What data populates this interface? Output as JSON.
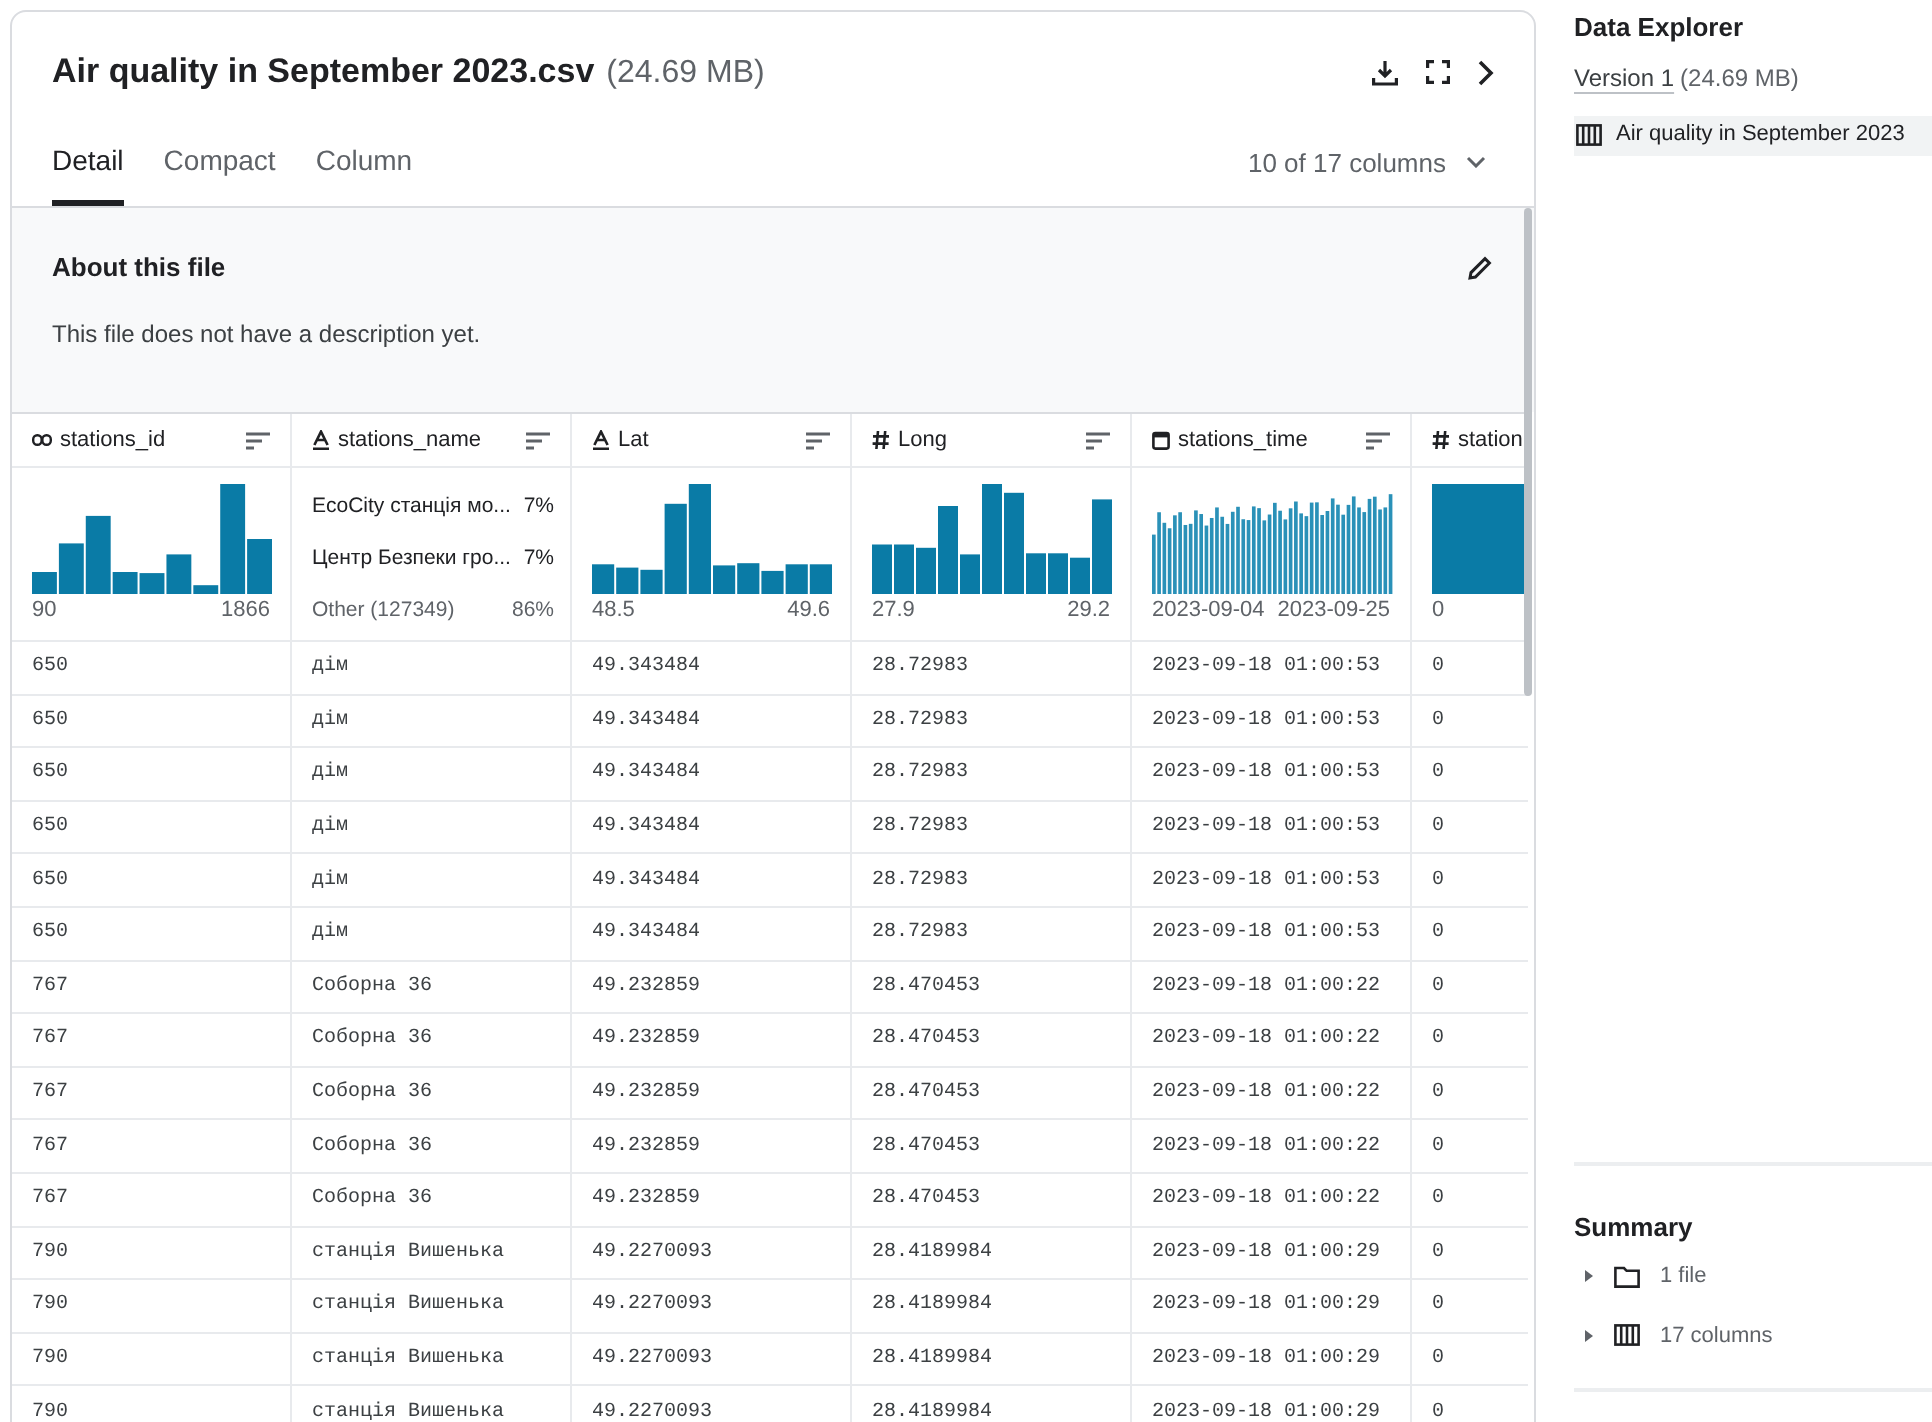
{
  "file": {
    "title": "Air quality in September 2023.csv",
    "size": "(24.69 MB)"
  },
  "tabs": [
    {
      "label": "Detail",
      "selected": true
    },
    {
      "label": "Compact",
      "selected": false
    },
    {
      "label": "Column",
      "selected": false
    }
  ],
  "column_count": "10 of 17 columns",
  "about": {
    "title": "About this file",
    "description": "This file does not have a description yet."
  },
  "table": {
    "columns": [
      {
        "name": "stations_id",
        "kind": "id",
        "summary": {
          "kind": "histogram",
          "min": "90",
          "max": "1866"
        }
      },
      {
        "name": "stations_name",
        "kind": "string",
        "summary": {
          "kind": "categories",
          "items": [
            {
              "label": "EcoCity станція мо...",
              "share": "7%",
              "muted": false
            },
            {
              "label": "Центр Безпеки гро...",
              "share": "7%",
              "muted": false
            },
            {
              "label": "Other (127349)",
              "share": "86%",
              "muted": true
            }
          ]
        }
      },
      {
        "name": "Lat",
        "kind": "string",
        "summary": {
          "kind": "histogram",
          "min": "48.5",
          "max": "49.6"
        }
      },
      {
        "name": "Long",
        "kind": "number",
        "summary": {
          "kind": "histogram",
          "min": "27.9",
          "max": "29.2"
        }
      },
      {
        "name": "stations_time",
        "kind": "date",
        "summary": {
          "kind": "timeline",
          "min": "2023-09-04",
          "max": "2023-09-25"
        }
      },
      {
        "name": "station",
        "kind": "number",
        "summary": {
          "kind": "histogram",
          "min": "0"
        }
      }
    ],
    "rows": [
      [
        "650",
        "дім",
        "49.343484",
        "28.72983",
        "2023-09-18 01:00:53",
        "0"
      ],
      [
        "650",
        "дім",
        "49.343484",
        "28.72983",
        "2023-09-18 01:00:53",
        "0"
      ],
      [
        "650",
        "дім",
        "49.343484",
        "28.72983",
        "2023-09-18 01:00:53",
        "0"
      ],
      [
        "650",
        "дім",
        "49.343484",
        "28.72983",
        "2023-09-18 01:00:53",
        "0"
      ],
      [
        "650",
        "дім",
        "49.343484",
        "28.72983",
        "2023-09-18 01:00:53",
        "0"
      ],
      [
        "650",
        "дім",
        "49.343484",
        "28.72983",
        "2023-09-18 01:00:53",
        "0"
      ],
      [
        "767",
        "Соборна 36",
        "49.232859",
        "28.470453",
        "2023-09-18 01:00:22",
        "0"
      ],
      [
        "767",
        "Соборна 36",
        "49.232859",
        "28.470453",
        "2023-09-18 01:00:22",
        "0"
      ],
      [
        "767",
        "Соборна 36",
        "49.232859",
        "28.470453",
        "2023-09-18 01:00:22",
        "0"
      ],
      [
        "767",
        "Соборна 36",
        "49.232859",
        "28.470453",
        "2023-09-18 01:00:22",
        "0"
      ],
      [
        "767",
        "Соборна 36",
        "49.232859",
        "28.470453",
        "2023-09-18 01:00:22",
        "0"
      ],
      [
        "790",
        "станція Вишенька",
        "49.2270093",
        "28.4189984",
        "2023-09-18 01:00:29",
        "0"
      ],
      [
        "790",
        "станція Вишенька",
        "49.2270093",
        "28.4189984",
        "2023-09-18 01:00:29",
        "0"
      ],
      [
        "790",
        "станція Вишенька",
        "49.2270093",
        "28.4189984",
        "2023-09-18 01:00:29",
        "0"
      ],
      [
        "790",
        "станція Вишенька",
        "49.2270093",
        "28.4189984",
        "2023-09-18 01:00:29",
        "0"
      ]
    ]
  },
  "sidebar": {
    "title": "Data Explorer",
    "version_link": "Version 1",
    "version_size": "(24.69 MB)",
    "files": [
      {
        "name": "Air quality in September 2023",
        "selected": true
      }
    ],
    "summary": {
      "title": "Summary",
      "items": [
        {
          "kind": "folder",
          "label": "1 file",
          "expanded": false
        },
        {
          "kind": "columns",
          "label": "17 columns",
          "expanded": false
        }
      ]
    }
  }
}
